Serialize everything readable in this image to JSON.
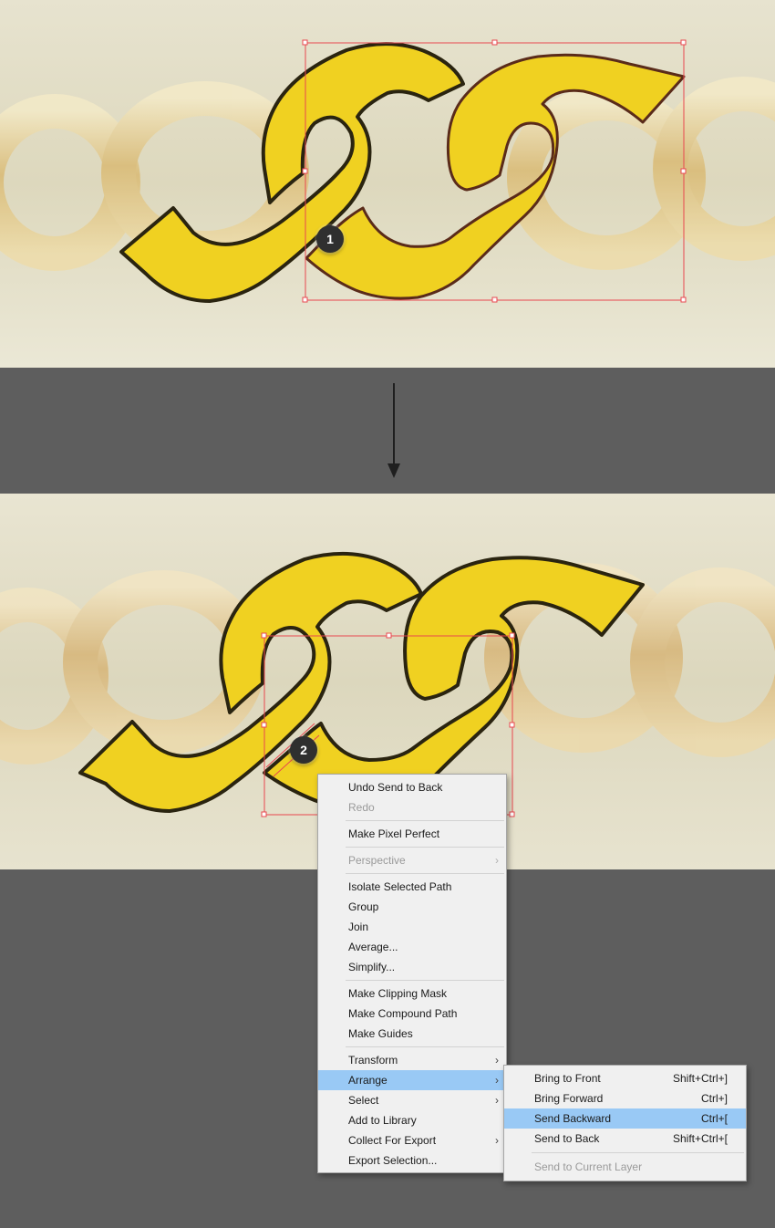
{
  "steps": {
    "first": "1",
    "second": "2"
  },
  "context_menu": {
    "groups": [
      [
        {
          "label": "Undo Send to Back"
        },
        {
          "label": "Redo",
          "disabled": true
        }
      ],
      [
        {
          "label": "Make Pixel Perfect"
        }
      ],
      [
        {
          "label": "Perspective",
          "disabled": true,
          "submenu": true
        }
      ],
      [
        {
          "label": "Isolate Selected Path"
        },
        {
          "label": "Group"
        },
        {
          "label": "Join"
        },
        {
          "label": "Average..."
        },
        {
          "label": "Simplify..."
        }
      ],
      [
        {
          "label": "Make Clipping Mask"
        },
        {
          "label": "Make Compound Path"
        },
        {
          "label": "Make Guides"
        }
      ],
      [
        {
          "label": "Transform",
          "submenu": true
        },
        {
          "label": "Arrange",
          "submenu": true,
          "active": true
        },
        {
          "label": "Select",
          "submenu": true
        },
        {
          "label": "Add to Library"
        },
        {
          "label": "Collect For Export",
          "submenu": true
        },
        {
          "label": "Export Selection..."
        }
      ]
    ]
  },
  "arrange_submenu": {
    "items": [
      {
        "label": "Bring to Front",
        "shortcut": "Shift+Ctrl+]"
      },
      {
        "label": "Bring Forward",
        "shortcut": "Ctrl+]"
      },
      {
        "label": "Send Backward",
        "shortcut": "Ctrl+[",
        "active": true
      },
      {
        "label": "Send to Back",
        "shortcut": "Shift+Ctrl+["
      }
    ],
    "extra": {
      "label": "Send to Current Layer",
      "disabled": true
    }
  },
  "colors": {
    "link_fill": "#f0d121",
    "link_stroke": "#2a2410",
    "selection": "#e8474f",
    "menu_highlight": "#99c9f5",
    "backdrop": "#5e5e5e"
  },
  "icons": {
    "submenu_arrow": "›"
  }
}
